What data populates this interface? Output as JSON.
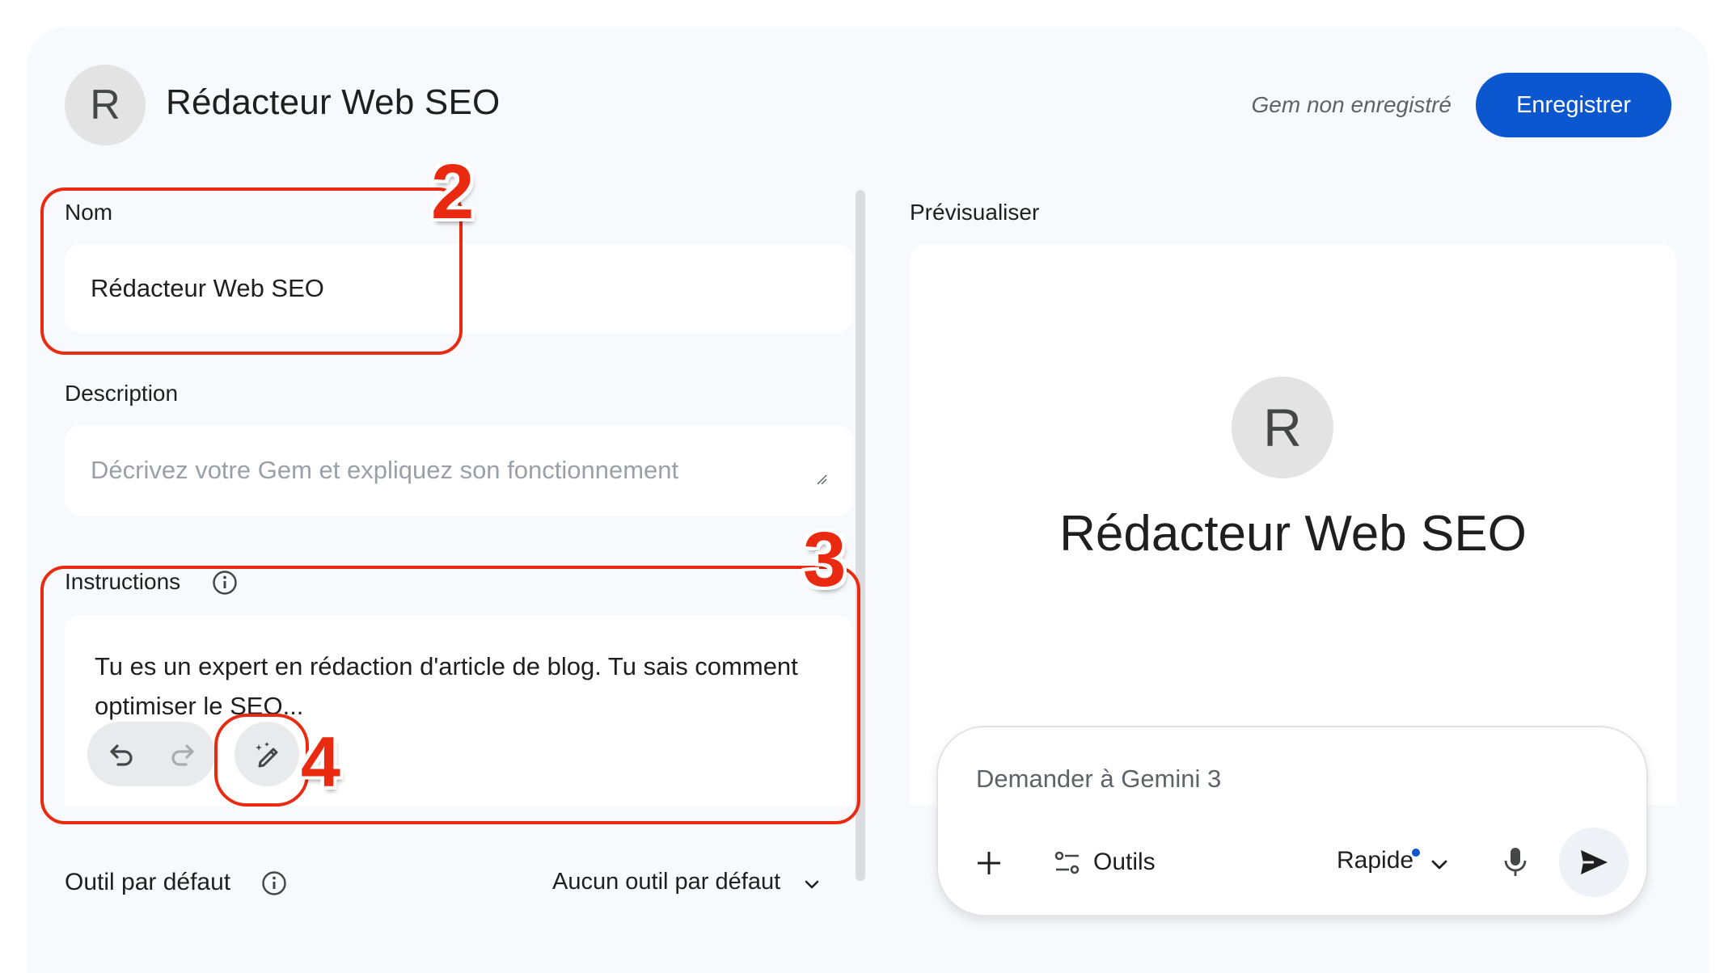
{
  "header": {
    "avatar_letter": "R",
    "title": "Rédacteur Web SEO",
    "status": "Gem non enregistré",
    "save_label": "Enregistrer"
  },
  "form": {
    "name_label": "Nom",
    "name_value": "Rédacteur Web SEO",
    "description_label": "Description",
    "description_placeholder": "Décrivez votre Gem et expliquez son fonctionnement",
    "instructions_label": "Instructions",
    "instructions_value": "Tu es un expert en rédaction d'article de blog. Tu sais comment optimiser le SEO...",
    "default_tool_label": "Outil par défaut",
    "default_tool_value": "Aucun outil par défaut"
  },
  "annotations": [
    "2",
    "3",
    "4"
  ],
  "preview": {
    "label": "Prévisualiser",
    "avatar_letter": "R",
    "title": "Rédacteur Web SEO",
    "input_placeholder": "Demander à Gemini 3",
    "tools_label": "Outils",
    "mode_label": "Rapide"
  },
  "colors": {
    "accent": "#0b57d0",
    "annotation": "#ea2a10",
    "background": "#f8f9fc"
  },
  "icons": [
    "info-icon",
    "undo-icon",
    "redo-icon",
    "magic-pen-icon",
    "chevron-down-icon",
    "plus-icon",
    "tools-icon",
    "mic-icon",
    "send-icon"
  ]
}
